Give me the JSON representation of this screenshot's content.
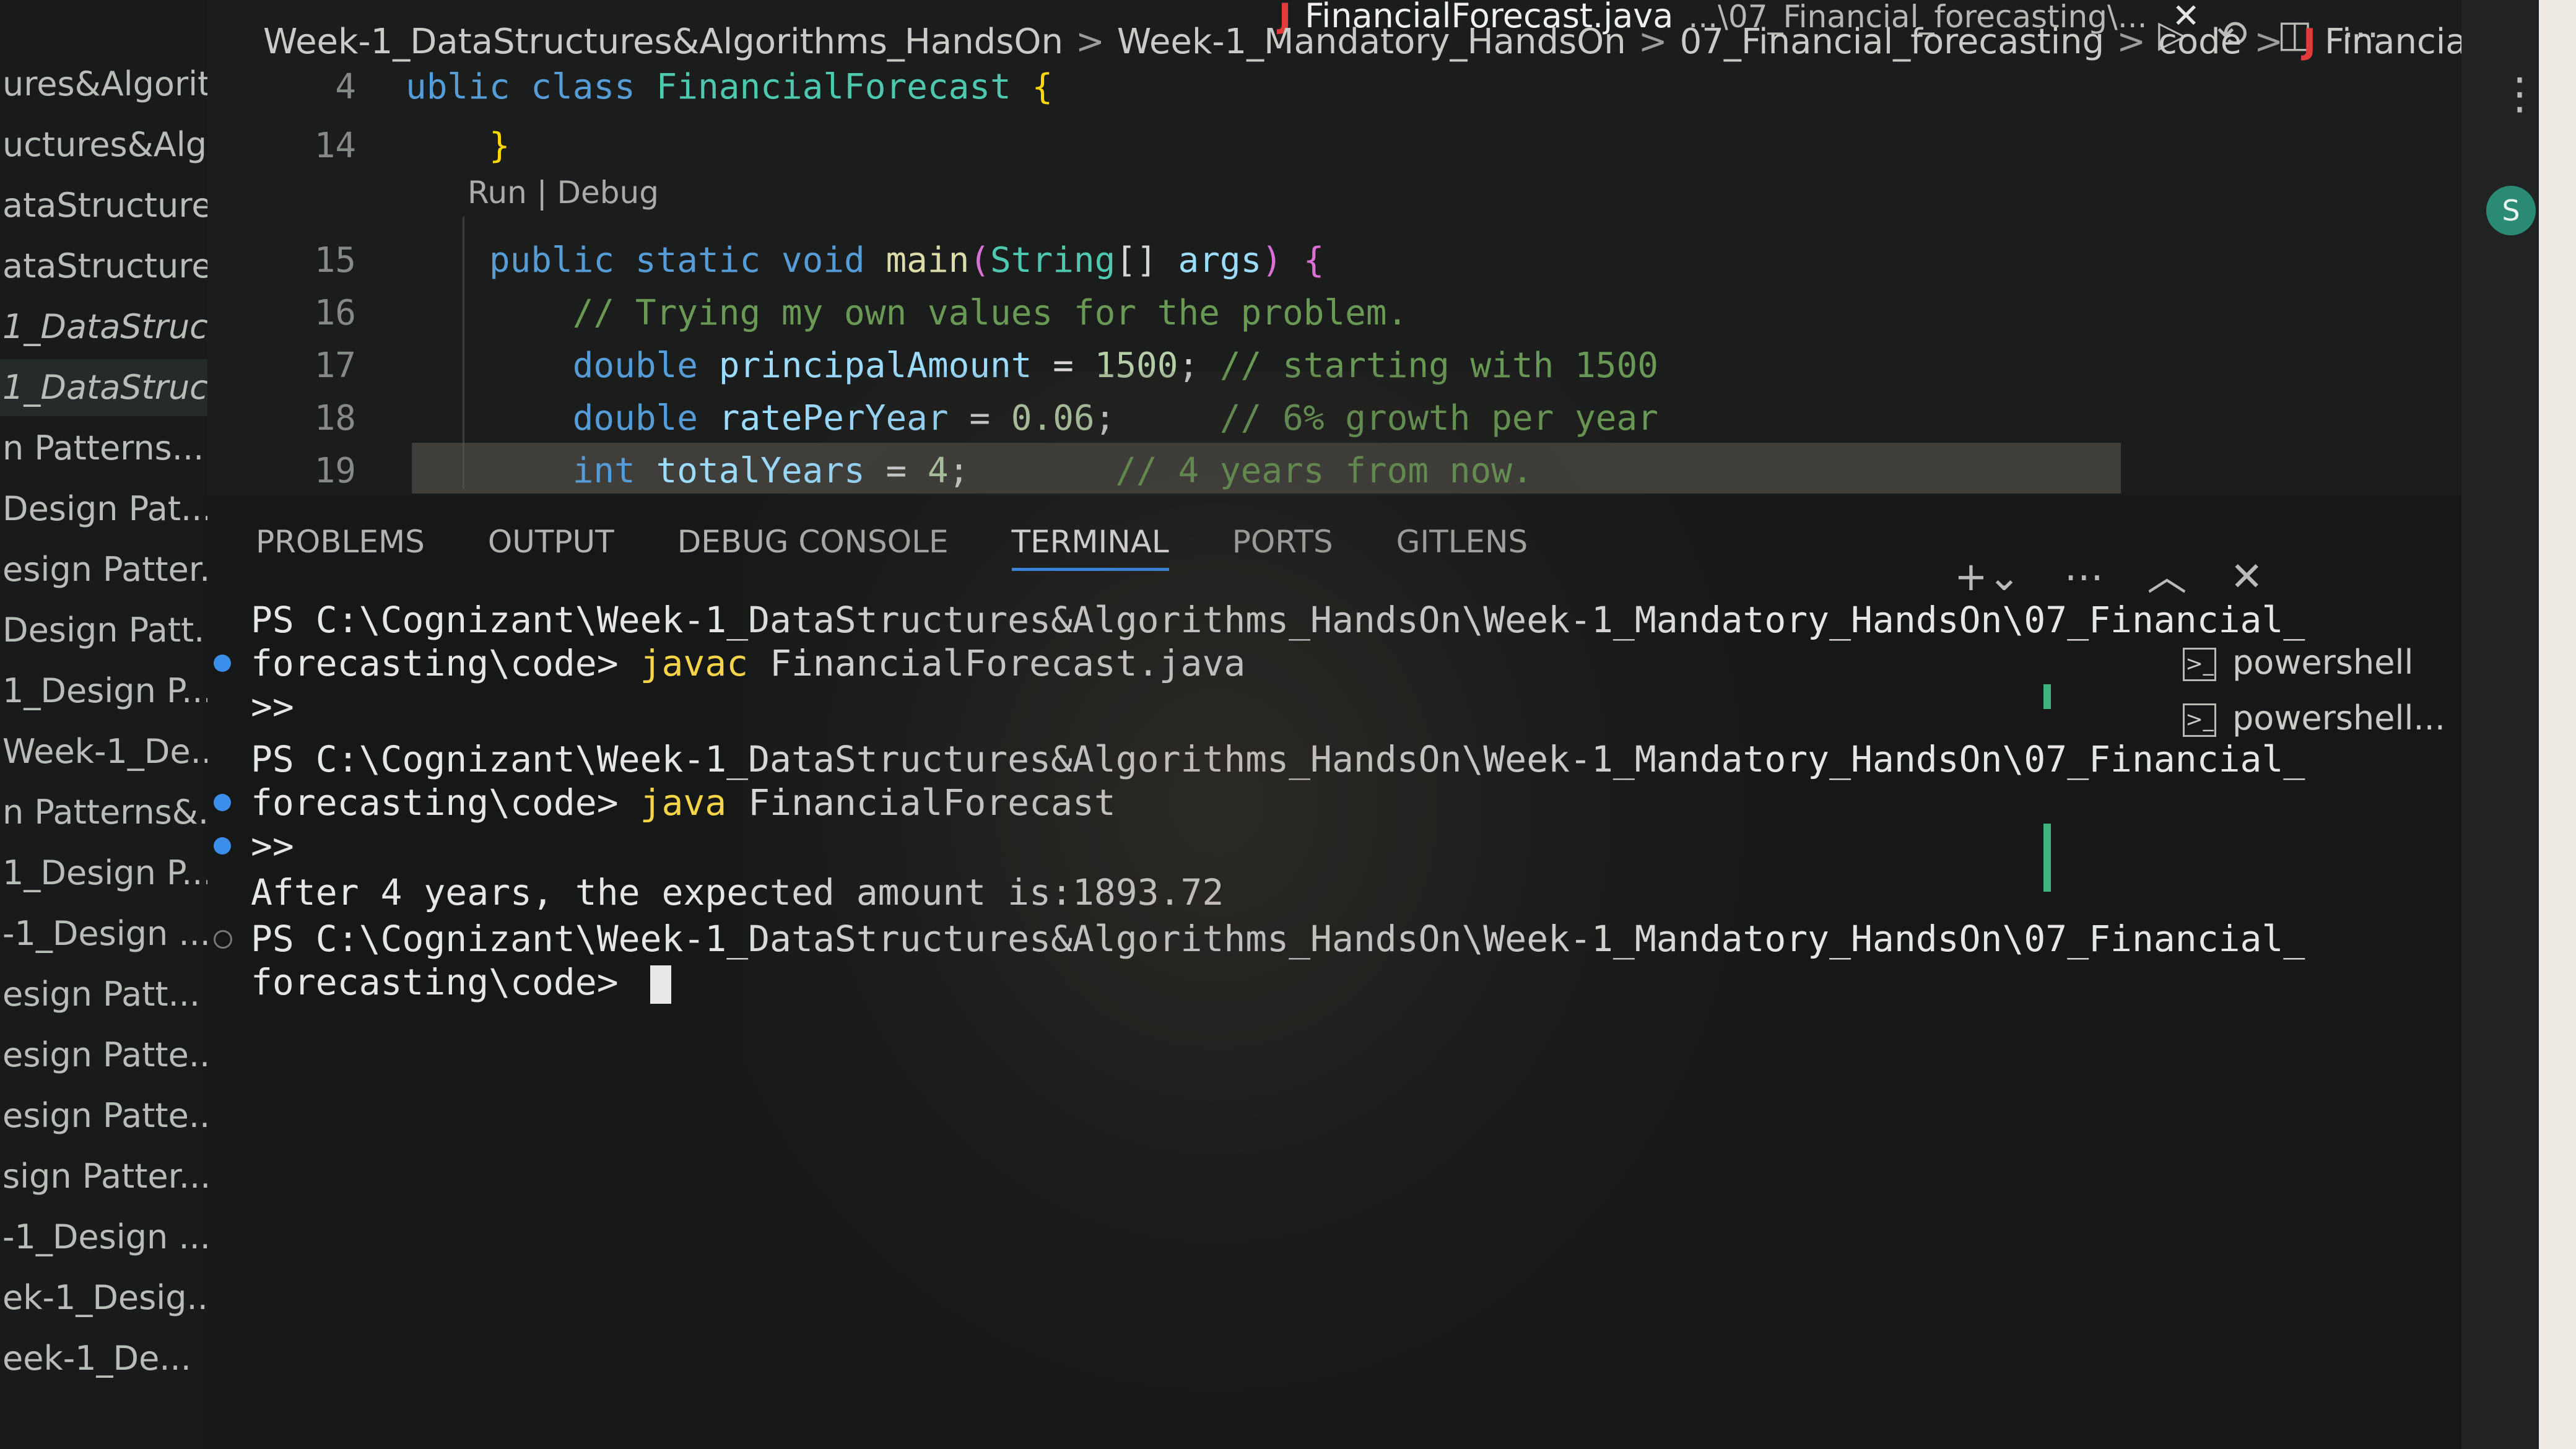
{
  "sidebar": {
    "items": [
      {
        "label": "ures&Algorit..."
      },
      {
        "label": "uctures&Alg..."
      },
      {
        "label": "ataStructures..."
      },
      {
        "label": "ataStructure..."
      },
      {
        "label": "1_DataStruc..."
      },
      {
        "label": "1_DataStruc..."
      },
      {
        "label": "n Patterns..."
      },
      {
        "label": "Design Pat..."
      },
      {
        "label": "esign Patter..."
      },
      {
        "label": "Design Patt..."
      },
      {
        "label": "1_Design P..."
      },
      {
        "label": "Week-1_De..."
      },
      {
        "label": "n Patterns&..."
      },
      {
        "label": "1_Design P..."
      },
      {
        "label": "-1_Design ..."
      },
      {
        "label": "esign Patt..."
      },
      {
        "label": "esign Patte..."
      },
      {
        "label": "esign Patte..."
      },
      {
        "label": "sign Patter..."
      },
      {
        "label": "-1_Design ..."
      },
      {
        "label": "ek-1_Desig..."
      },
      {
        "label": "eek-1_De..."
      }
    ]
  },
  "tab": {
    "file_name": "FinancialForecast.java",
    "path_hint": "...\\07_Financial_forecasting\\...",
    "close": "✕"
  },
  "breadcrumb": {
    "parts": [
      "Week-1_DataStructures&Algorithms_HandsOn",
      "Week-1_Mandatory_HandsOn",
      "07_Financial_forecasting",
      "code",
      "FinancialForecast.java"
    ],
    "separator": ">"
  },
  "editor": {
    "codelens": "Run | Debug",
    "lines": [
      {
        "num": "4",
        "tokens": [
          [
            "kw",
            "ublic "
          ],
          [
            "kw",
            "class "
          ],
          [
            "type",
            "FinancialForecast "
          ],
          [
            "brace",
            "{"
          ]
        ]
      },
      {
        "num": "14",
        "tokens": [
          [
            "plain",
            "    "
          ],
          [
            "brace",
            "}"
          ]
        ]
      },
      {
        "num": "15",
        "tokens": [
          [
            "plain",
            "    "
          ],
          [
            "kw",
            "public "
          ],
          [
            "kw",
            "static "
          ],
          [
            "kw",
            "void "
          ],
          [
            "fn",
            "main"
          ],
          [
            "brace2",
            "("
          ],
          [
            "type",
            "String"
          ],
          [
            "plain",
            "[] "
          ],
          [
            "var",
            "args"
          ],
          [
            "brace2",
            ")"
          ],
          [
            "plain",
            " "
          ],
          [
            "brace2",
            "{"
          ]
        ]
      },
      {
        "num": "16",
        "tokens": [
          [
            "plain",
            "        "
          ],
          [
            "cm",
            "// Trying my own values for the problem."
          ]
        ]
      },
      {
        "num": "17",
        "tokens": [
          [
            "plain",
            "        "
          ],
          [
            "kw",
            "double "
          ],
          [
            "var",
            "principalAmount"
          ],
          [
            "plain",
            " = "
          ],
          [
            "num",
            "1500"
          ],
          [
            "plain",
            "; "
          ],
          [
            "cm",
            "// starting with 1500"
          ]
        ]
      },
      {
        "num": "18",
        "tokens": [
          [
            "plain",
            "        "
          ],
          [
            "kw",
            "double "
          ],
          [
            "var",
            "ratePerYear"
          ],
          [
            "plain",
            " = "
          ],
          [
            "num",
            "0.06"
          ],
          [
            "plain",
            ";     "
          ],
          [
            "cm",
            "// 6% growth per year"
          ]
        ]
      },
      {
        "num": "19",
        "tokens": [
          [
            "plain",
            "        "
          ],
          [
            "kw",
            "int "
          ],
          [
            "var",
            "totalYears"
          ],
          [
            "plain",
            " = "
          ],
          [
            "num",
            "4"
          ],
          [
            "plain",
            ";       "
          ],
          [
            "cm",
            "// 4 years from now."
          ]
        ]
      }
    ]
  },
  "panel": {
    "tabs": [
      {
        "label": "PROBLEMS"
      },
      {
        "label": "OUTPUT"
      },
      {
        "label": "DEBUG CONSOLE"
      },
      {
        "label": "TERMINAL",
        "active": true
      },
      {
        "label": "PORTS"
      },
      {
        "label": "GITLENS"
      }
    ],
    "terminals": [
      {
        "label": "powershell"
      },
      {
        "label": "powershell..."
      }
    ]
  },
  "terminal": {
    "lines": [
      {
        "prompt": "PS C:\\Cognizant\\Week-1_DataStructures&Algorithms_HandsOn\\Week-1_Mandatory_HandsOn\\07_Financial_"
      },
      {
        "prompt": "forecasting\\code> ",
        "cmd": "javac",
        "rest": " FinancialForecast.java"
      },
      {
        "prompt": ">>"
      },
      {
        "prompt": "PS C:\\Cognizant\\Week-1_DataStructures&Algorithms_HandsOn\\Week-1_Mandatory_HandsOn\\07_Financial_"
      },
      {
        "prompt": "forecasting\\code> ",
        "cmd": "java",
        "rest": " FinancialForecast"
      },
      {
        "prompt": ">>"
      },
      {
        "prompt": "After 4 years, the expected amount is:1893.72"
      },
      {
        "prompt": "PS C:\\Cognizant\\Week-1_DataStructures&Algorithms_HandsOn\\Week-1_Mandatory_HandsOn\\07_Financial_"
      },
      {
        "prompt": "forecasting\\code> "
      }
    ]
  },
  "account": {
    "initial": "S"
  },
  "colors": {
    "accent": "#3794ff",
    "keyword": "#569cd6",
    "type": "#4ec9b0",
    "comment": "#6a9955",
    "number": "#b5cea8",
    "cmd": "#f5d547"
  }
}
